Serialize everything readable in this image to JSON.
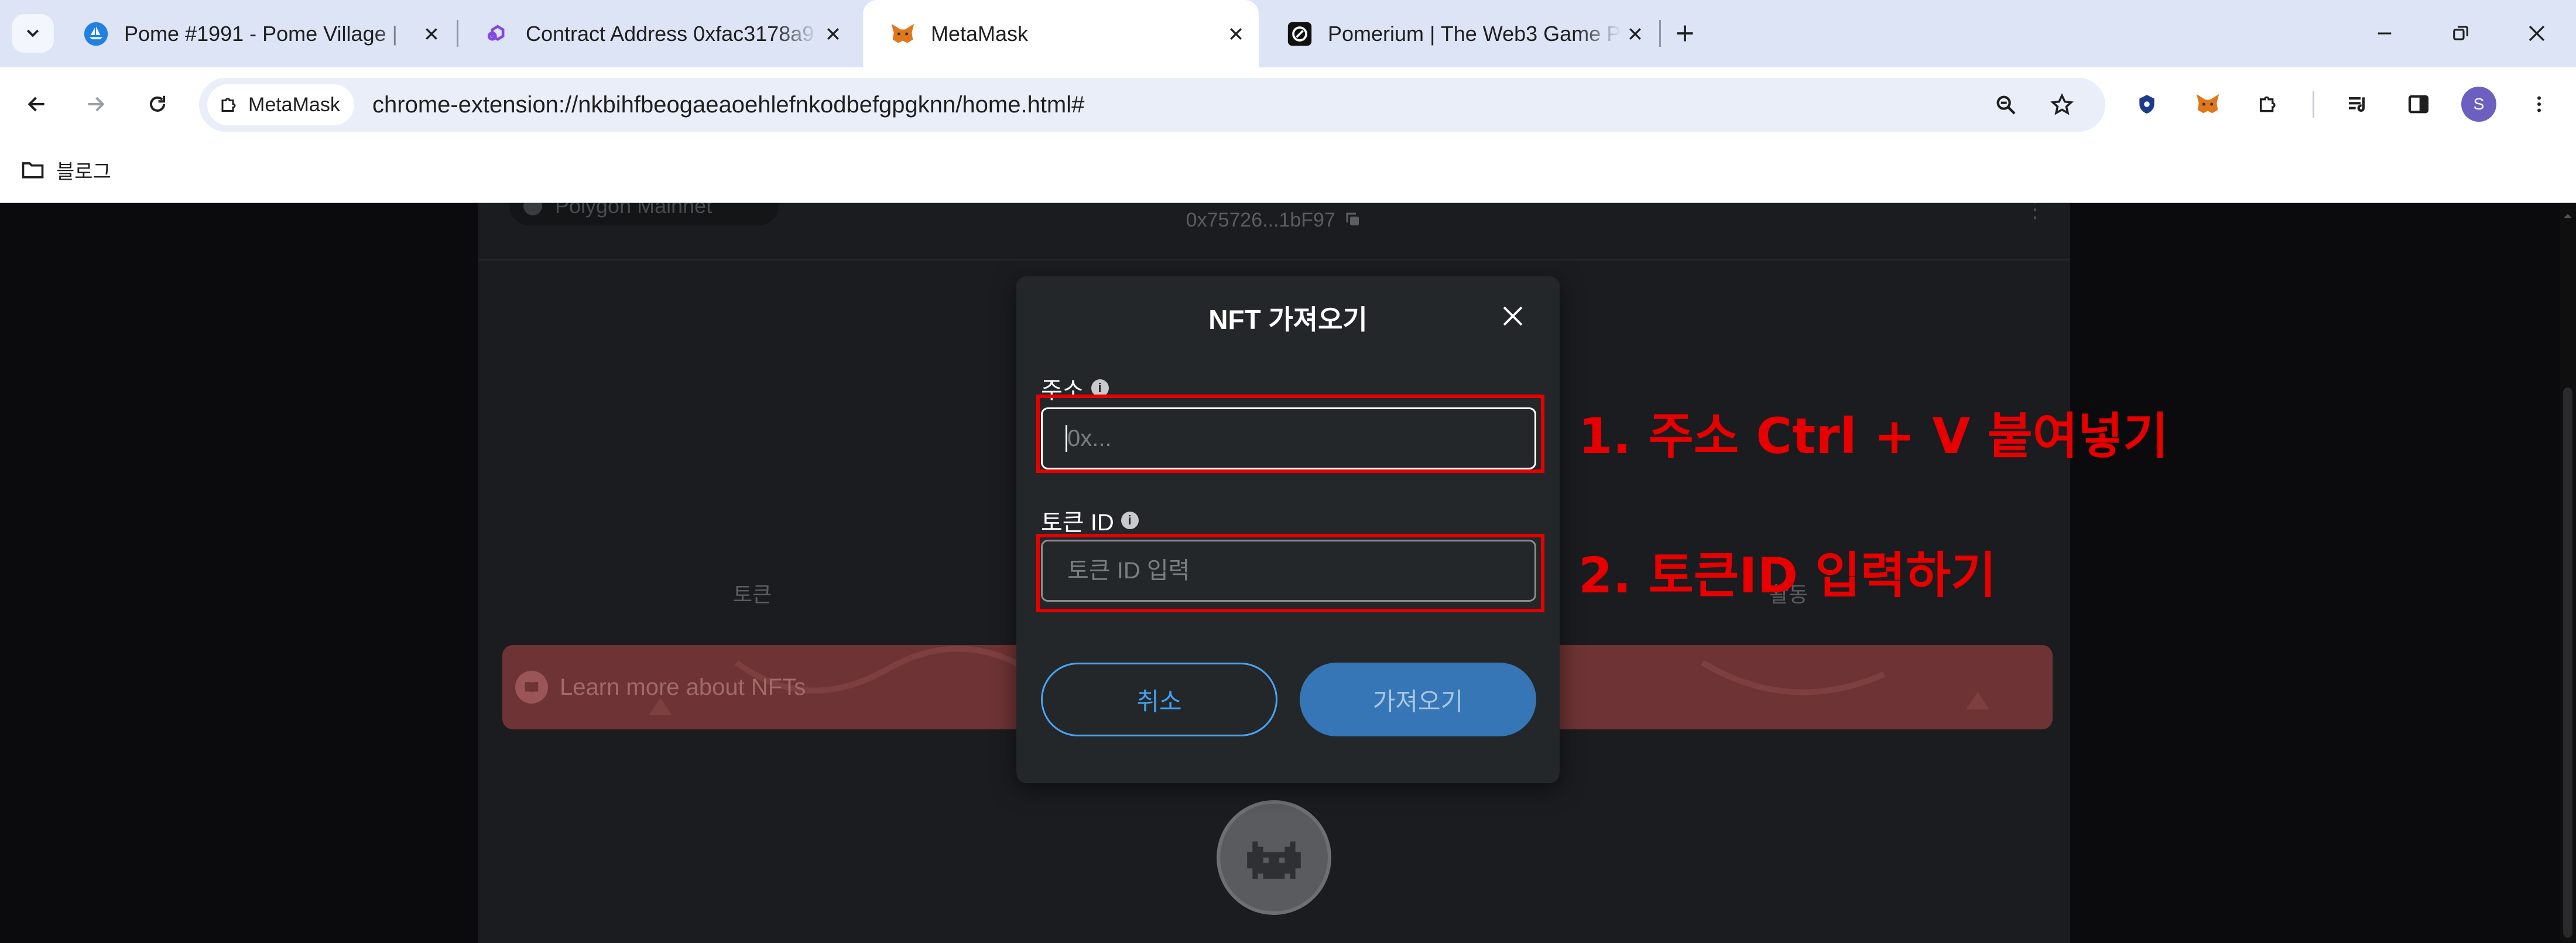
{
  "browser": {
    "tabs": [
      {
        "title": "Pome #1991 - Pome Village | ",
        "favicon": "opensea-icon",
        "color": "#2081e2"
      },
      {
        "title": "Contract Address 0xfac3178a9",
        "favicon": "polygonscan-icon",
        "color": "#8247e5"
      },
      {
        "title": "MetaMask",
        "favicon": "metamask-fox-icon",
        "color": "#e2761b",
        "active": true
      },
      {
        "title": "Pomerium | The Web3 Game P",
        "favicon": "pomerium-icon",
        "color": "#111111"
      }
    ],
    "site_chip": "MetaMask",
    "url": "chrome-extension://nkbihfbeogaeaoehlefnkodbefgpgknn/home.html#",
    "avatar_letter": "S",
    "bookmark_folder": "블로그"
  },
  "metamask": {
    "network": "Polygon Mainnet",
    "account_address": "0x75726...1bF97",
    "tabs": {
      "tokens": "토큰",
      "activity": "활동"
    },
    "learn_more": "Learn more about NFTs"
  },
  "modal": {
    "title": "NFT 가져오기",
    "address_label": "주소",
    "address_placeholder": "0x...",
    "token_id_label": "토큰 ID",
    "token_id_placeholder": "토큰 ID 입력",
    "cancel_label": "취소",
    "import_label": "가져오기"
  },
  "annotations": {
    "step1": "1. 주소 Ctrl + V 붙여넣기",
    "step2": "2. 토큰ID 입력하기",
    "color": "#e60000"
  }
}
